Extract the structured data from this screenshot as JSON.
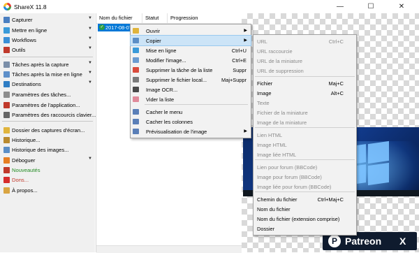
{
  "window": {
    "title": "ShareX 11.8",
    "minimize": "—",
    "maximize": "☐",
    "close": "✕"
  },
  "sidebar": {
    "items": [
      {
        "label": "Capturer",
        "icon": "camera-icon",
        "color": "#4a7fc1",
        "arrow": true
      },
      {
        "label": "Mettre en ligne",
        "icon": "upload-icon",
        "color": "#3a9ad9",
        "arrow": true
      },
      {
        "label": "Workflows",
        "icon": "workflow-icon",
        "color": "#3b8fd6",
        "arrow": true
      },
      {
        "label": "Outils",
        "icon": "toolbox-icon",
        "color": "#c0392b",
        "arrow": true
      },
      {
        "label": "Tâches après la capture",
        "icon": "task-capture-icon",
        "color": "#7a8ea8",
        "arrow": true
      },
      {
        "label": "Tâches après la mise en ligne",
        "icon": "task-upload-icon",
        "color": "#5d8fc9",
        "arrow": true
      },
      {
        "label": "Destinations",
        "icon": "globe-icon",
        "color": "#2e7dc4",
        "arrow": true
      },
      {
        "label": "Paramètres des tâches...",
        "icon": "settings-gear-icon",
        "color": "#8c8c8c",
        "arrow": false
      },
      {
        "label": "Paramètres de l'application...",
        "icon": "tools-icon",
        "color": "#c0392b",
        "arrow": false
      },
      {
        "label": "Paramètres des raccourcis clavier...",
        "icon": "keyboard-icon",
        "color": "#666666",
        "arrow": false
      },
      {
        "label": "Dossier des captures d'écran...",
        "icon": "folder-icon",
        "color": "#e0b43c",
        "arrow": false
      },
      {
        "label": "Historique...",
        "icon": "history-icon",
        "color": "#b98a2f",
        "arrow": false
      },
      {
        "label": "Historique des images...",
        "icon": "image-history-icon",
        "color": "#5b8ec6",
        "arrow": false
      },
      {
        "label": "Déboguer",
        "icon": "debug-icon",
        "color": "#e67e22",
        "arrow": true
      },
      {
        "label": "Nouveautés",
        "icon": "megaphone-icon",
        "color": "#c0392b",
        "arrow": false,
        "text_color": "#228b22"
      },
      {
        "label": "Dons...",
        "icon": "heart-icon",
        "color": "#d62c2c",
        "arrow": false,
        "text_color": "#c0392b"
      },
      {
        "label": "À propos...",
        "icon": "about-icon",
        "color": "#d9a441",
        "arrow": false
      }
    ]
  },
  "list": {
    "columns": [
      "Nom du fichier",
      "Statut",
      "Progression"
    ],
    "selected_row": "2017-08-07"
  },
  "context_menu": {
    "items": [
      {
        "label": "Ouvrir",
        "icon": "open-icon",
        "color": "#e0b43c",
        "shortcut": "",
        "arrow": true
      },
      {
        "label": "Copier",
        "icon": "copy-icon",
        "color": "#5b8ec6",
        "shortcut": "",
        "arrow": true,
        "highlighted": true
      },
      {
        "label": "Mise en ligne",
        "icon": "upload-icon",
        "color": "#3a9ad9",
        "shortcut": "Ctrl+U",
        "arrow": false
      },
      {
        "label": "Modifier l'image...",
        "icon": "edit-image-icon",
        "color": "#6a9bd1",
        "shortcut": "Ctrl+E",
        "arrow": false
      },
      {
        "label": "Supprimer la tâche de la liste",
        "icon": "remove-icon",
        "color": "#d94b3c",
        "shortcut": "Suppr",
        "arrow": false
      },
      {
        "label": "Supprimer le fichier local...",
        "icon": "delete-file-icon",
        "color": "#7a7a7a",
        "shortcut": "Maj+Suppr",
        "arrow": false
      },
      {
        "label": "Image OCR...",
        "icon": "ocr-icon",
        "color": "#4a4a4a",
        "shortcut": "",
        "arrow": false
      },
      {
        "label": "Vider la liste",
        "icon": "eraser-icon",
        "color": "#e08a9a",
        "shortcut": "",
        "arrow": false
      },
      {
        "label": "Cacher le menu",
        "icon": "menu-icon",
        "color": "#5a7fb8",
        "shortcut": "",
        "arrow": false
      },
      {
        "label": "Cacher les colonnes",
        "icon": "columns-icon",
        "color": "#5a7fb8",
        "shortcut": "",
        "arrow": false
      },
      {
        "label": "Prévisualisation de l'image",
        "icon": "preview-icon",
        "color": "#5a7fb8",
        "shortcut": "",
        "arrow": true
      }
    ]
  },
  "copy_submenu": {
    "items": [
      {
        "label": "URL",
        "shortcut": "Ctrl+C",
        "disabled": true
      },
      {
        "label": "URL raccourcie",
        "shortcut": "",
        "disabled": true
      },
      {
        "label": "URL de la miniature",
        "shortcut": "",
        "disabled": true
      },
      {
        "label": "URL de suppression",
        "shortcut": "",
        "disabled": true
      },
      {
        "label": "Fichier",
        "shortcut": "Maj+C",
        "disabled": false
      },
      {
        "label": "Image",
        "shortcut": "Alt+C",
        "disabled": false
      },
      {
        "label": "Texte",
        "shortcut": "",
        "disabled": true
      },
      {
        "label": "Fichier de la miniature",
        "shortcut": "",
        "disabled": true
      },
      {
        "label": "Image de la miniature",
        "shortcut": "",
        "disabled": true
      },
      {
        "label": "Lien HTML",
        "shortcut": "",
        "disabled": true
      },
      {
        "label": "Image HTML",
        "shortcut": "",
        "disabled": true
      },
      {
        "label": "Image liée HTML",
        "shortcut": "",
        "disabled": true
      },
      {
        "label": "Lien pour forum (BBCode)",
        "shortcut": "",
        "disabled": true
      },
      {
        "label": "Image pour forum (BBCode)",
        "shortcut": "",
        "disabled": true
      },
      {
        "label": "Image liée pour forum (BBCode)",
        "shortcut": "",
        "disabled": true
      },
      {
        "label": "Chemin du fichier",
        "shortcut": "Ctrl+Maj+C",
        "disabled": false
      },
      {
        "label": "Nom du fichier",
        "shortcut": "",
        "disabled": false
      },
      {
        "label": "Nom du fichier (extension comprise)",
        "shortcut": "",
        "disabled": false
      },
      {
        "label": "Dossier",
        "shortcut": "",
        "disabled": false
      }
    ]
  },
  "badge": {
    "brand": "Patreon",
    "letter": "X",
    "color": "#0f1b2e"
  }
}
